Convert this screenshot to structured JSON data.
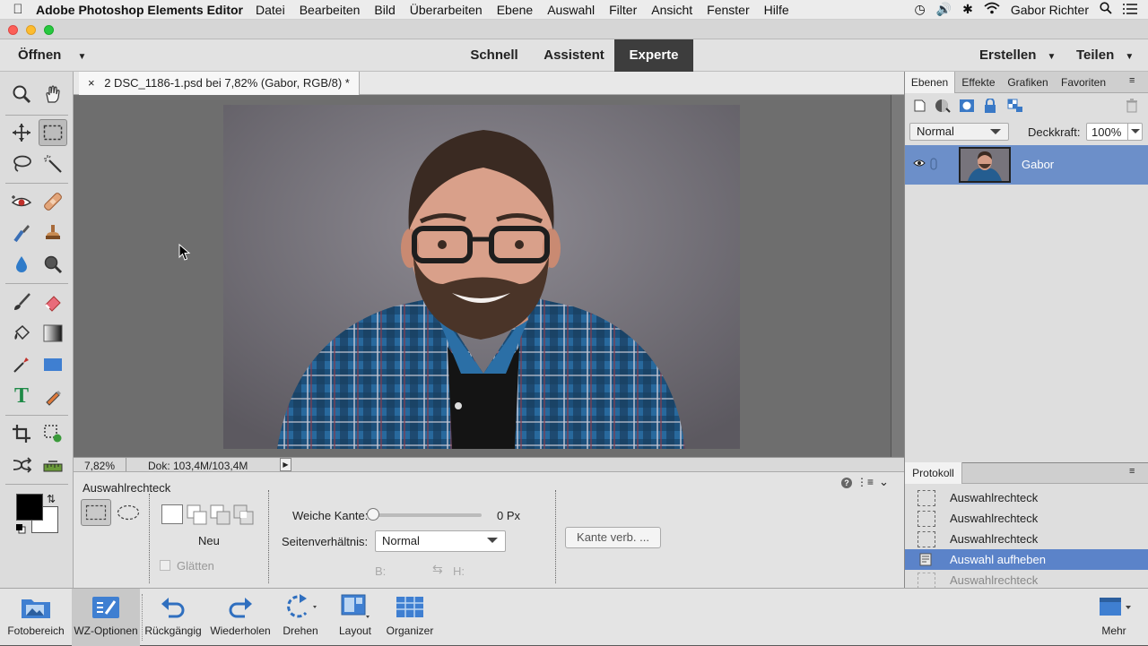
{
  "menubar": {
    "app": "Adobe Photoshop Elements Editor",
    "items": [
      "Datei",
      "Bearbeiten",
      "Bild",
      "Überarbeiten",
      "Ebene",
      "Auswahl",
      "Filter",
      "Ansicht",
      "Fenster",
      "Hilfe"
    ],
    "user": "Gabor Richter"
  },
  "modebar": {
    "open": "Öffnen",
    "modes": [
      "Schnell",
      "Assistent",
      "Experte"
    ],
    "active_mode": "Experte",
    "create": "Erstellen",
    "share": "Teilen"
  },
  "document": {
    "close": "×",
    "tab_title": "2 DSC_1186-1.psd bei 7,82% (Gabor, RGB/8) *",
    "zoom": "7,82%",
    "doc_info": "Dok: 103,4M/103,4M"
  },
  "options": {
    "title": "Auswahlrechteck",
    "mode_label": "Neu",
    "smooth_label": "Glätten",
    "feather_label": "Weiche Kante:",
    "feather_value": "0 Px",
    "feather_level": 0,
    "aspect_label": "Seitenverhältnis:",
    "aspect_value": "Normal",
    "width_label": "B:",
    "height_label": "H:",
    "refine_button": "Kante verb. ..."
  },
  "layers_panel": {
    "tabs": [
      "Ebenen",
      "Effekte",
      "Grafiken",
      "Favoriten"
    ],
    "active_tab": "Ebenen",
    "blend_mode": "Normal",
    "opacity_label": "Deckkraft:",
    "opacity_value": "100%",
    "layers": [
      {
        "name": "Gabor"
      }
    ]
  },
  "history_panel": {
    "tab": "Protokoll",
    "items": [
      "Auswahlrechteck",
      "Auswahlrechteck",
      "Auswahlrechteck",
      "Auswahl aufheben",
      "Auswahlrechteck"
    ],
    "selected_index": 3
  },
  "bottombar": {
    "items": [
      "Fotobereich",
      "WZ-Optionen",
      "Rückgängig",
      "Wiederholen",
      "Drehen",
      "Layout",
      "Organizer"
    ],
    "more": "Mehr"
  },
  "colors": {
    "accent_selection": "#6c8fc9",
    "history_selection": "#5b83c9",
    "foreground": "#000000",
    "background": "#ffffff"
  }
}
